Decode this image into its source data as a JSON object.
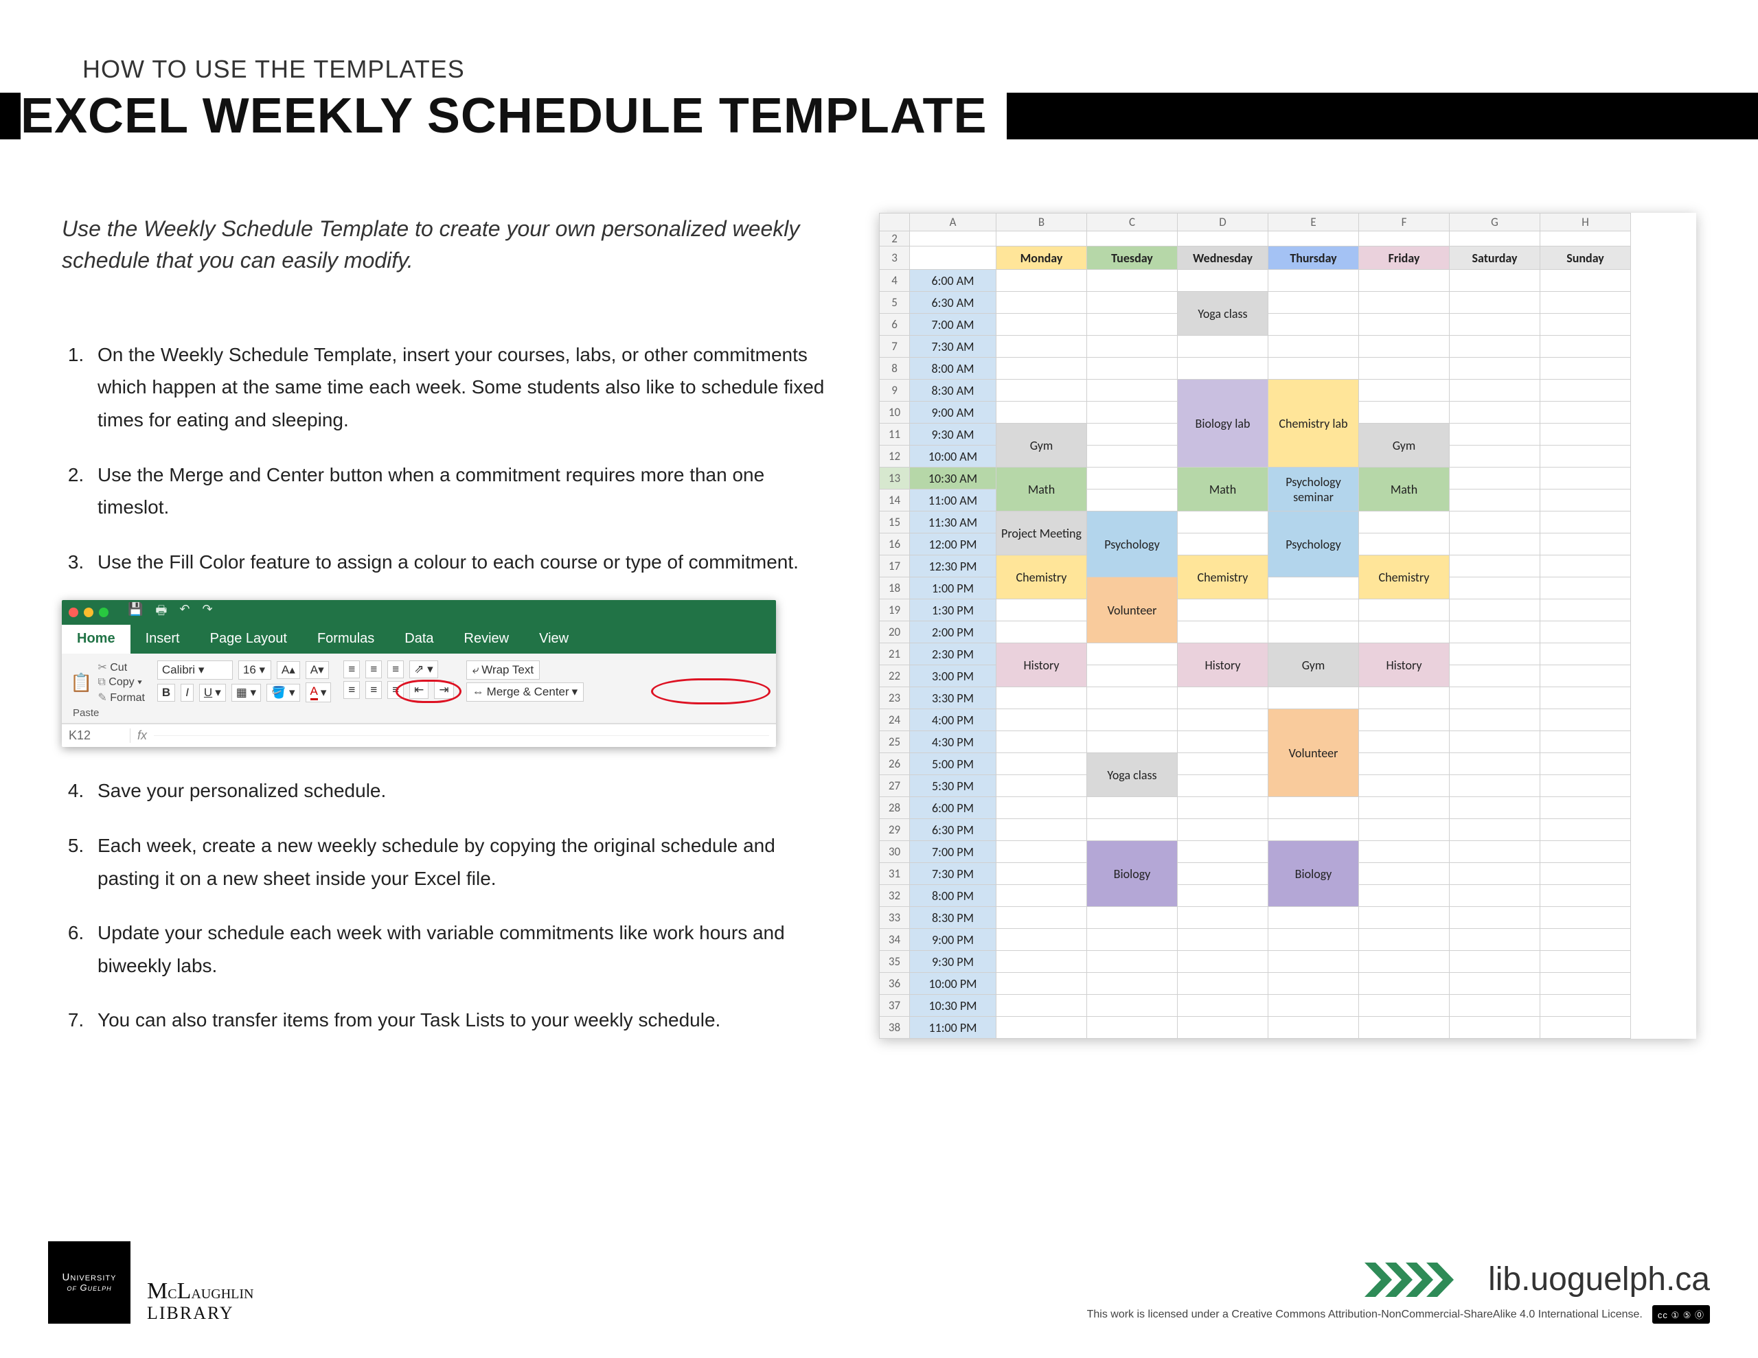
{
  "eyebrow": "HOW TO USE THE TEMPLATES",
  "title": "EXCEL WEEKLY SCHEDULE TEMPLATE",
  "intro": "Use the Weekly Schedule Template to create your own personalized weekly schedule that you can easily modify.",
  "steps": [
    "On the Weekly Schedule Template, insert your courses, labs, or other commitments which happen at the same time each week.  Some students also like to schedule fixed times for eating and sleeping.",
    "Use the Merge and Center button when a commitment requires more than one timeslot.",
    "Use the Fill Color feature to assign a colour to each course or type of commitment."
  ],
  "steps_after": [
    "Save your personalized schedule.",
    "Each week, create a new weekly schedule by copying the original schedule and pasting it on a new sheet inside your Excel file.",
    "Update your schedule each week with variable commitments like work hours and biweekly labs.",
    "You can also transfer items from your Task Lists to your weekly schedule."
  ],
  "ribbon": {
    "tabs": [
      "Home",
      "Insert",
      "Page Layout",
      "Formulas",
      "Data",
      "Review",
      "View"
    ],
    "paste": "Paste",
    "cut": "Cut",
    "copy": "Copy",
    "format": "Format",
    "font": "Calibri",
    "size": "16",
    "wrap": "Wrap Text",
    "merge": "Merge & Center",
    "cellref": "K12",
    "fx": "fx"
  },
  "schedule": {
    "columns": [
      "A",
      "B",
      "C",
      "D",
      "E",
      "F",
      "G",
      "H"
    ],
    "days": [
      "Monday",
      "Tuesday",
      "Wednesday",
      "Thursday",
      "Friday",
      "Saturday",
      "Sunday"
    ],
    "times": [
      "6:00 AM",
      "6:30 AM",
      "7:00 AM",
      "7:30 AM",
      "8:00 AM",
      "8:30 AM",
      "9:00 AM",
      "9:30 AM",
      "10:00 AM",
      "10:30 AM",
      "11:00 AM",
      "11:30 AM",
      "12:00 PM",
      "12:30 PM",
      "1:00 PM",
      "1:30 PM",
      "2:00 PM",
      "2:30 PM",
      "3:00 PM",
      "3:30 PM",
      "4:00 PM",
      "4:30 PM",
      "5:00 PM",
      "5:30 PM",
      "6:00 PM",
      "6:30 PM",
      "7:00 PM",
      "7:30 PM",
      "8:00 PM",
      "8:30 PM",
      "9:00 PM",
      "9:30 PM",
      "10:00 PM",
      "10:30 PM",
      "11:00 PM"
    ],
    "events": {
      "yoga1": "Yoga class",
      "biolab": "Biology lab",
      "chemlab": "Chemistry lab",
      "gym": "Gym",
      "math": "Math",
      "psysem": "Psychology seminar",
      "project": "Project Meeting",
      "psych": "Psychology",
      "chem": "Chemistry",
      "volunteer1": "Volunteer",
      "history": "History",
      "volunteer2": "Volunteer",
      "yoga2": "Yoga class",
      "biology": "Biology"
    }
  },
  "footer": {
    "badge1": "University",
    "badge2": "of Guelph",
    "mcl1": "McLaughlin",
    "mcl2": "LIBRARY",
    "url": "lib.uoguelph.ca",
    "license": "This work is licensed under a Creative Commons Attribution-NonCommercial-ShareAlike 4.0 International License.",
    "cc": "cc ① ⑤ ⓪"
  }
}
